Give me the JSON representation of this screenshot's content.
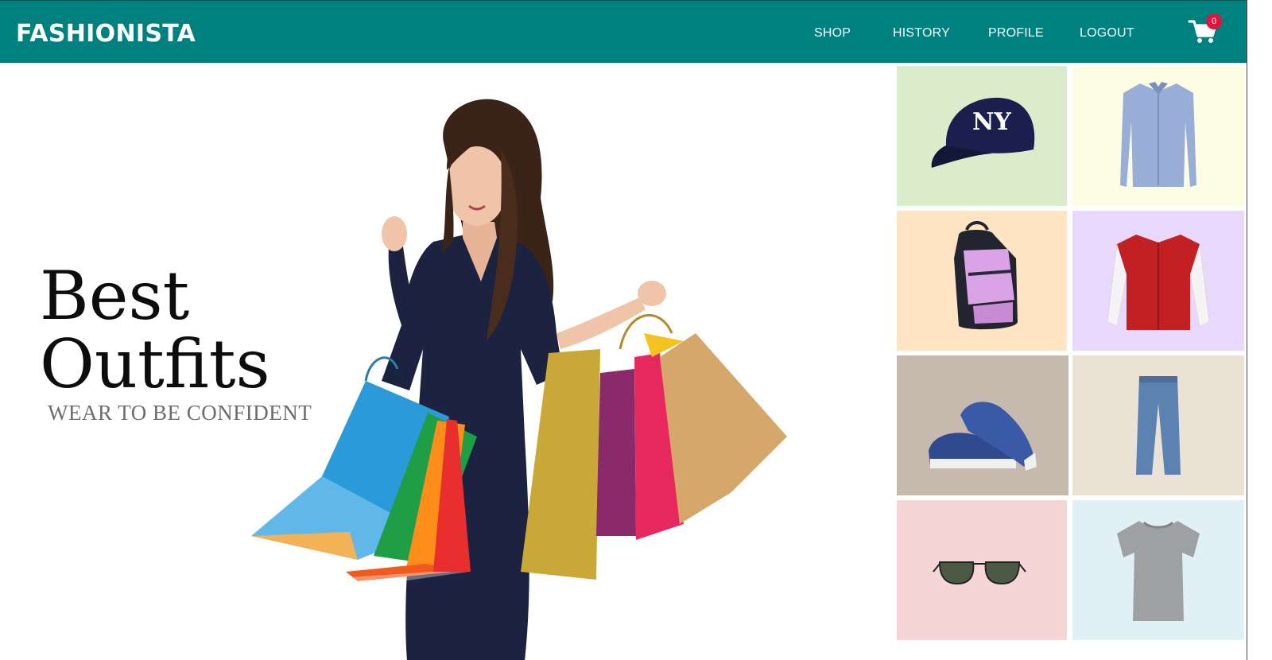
{
  "header": {
    "brand": "FASHIONISTA",
    "nav": [
      "SHOP",
      "HISTORY",
      "PROFILE",
      "LOGOUT"
    ],
    "cart_count": "0",
    "accent_color": "#018080",
    "badge_color": "#e0153f"
  },
  "hero": {
    "title_line1": "Best",
    "title_line2": "Outfits",
    "tagline": "WEAR TO BE CONFIDENT"
  },
  "products": [
    {
      "icon": "cap-icon",
      "bg": "#daecca"
    },
    {
      "icon": "shirt-icon",
      "bg": "#fcfde3"
    },
    {
      "icon": "backpack-icon",
      "bg": "#fde4c3"
    },
    {
      "icon": "jacket-icon",
      "bg": "#e8d8fb"
    },
    {
      "icon": "sneakers-icon",
      "bg": "#c6b9ae"
    },
    {
      "icon": "jeans-icon",
      "bg": "#ebe1d5"
    },
    {
      "icon": "sunglasses-icon",
      "bg": "#f6d5d7"
    },
    {
      "icon": "tshirt-icon",
      "bg": "#e1eff6"
    }
  ]
}
